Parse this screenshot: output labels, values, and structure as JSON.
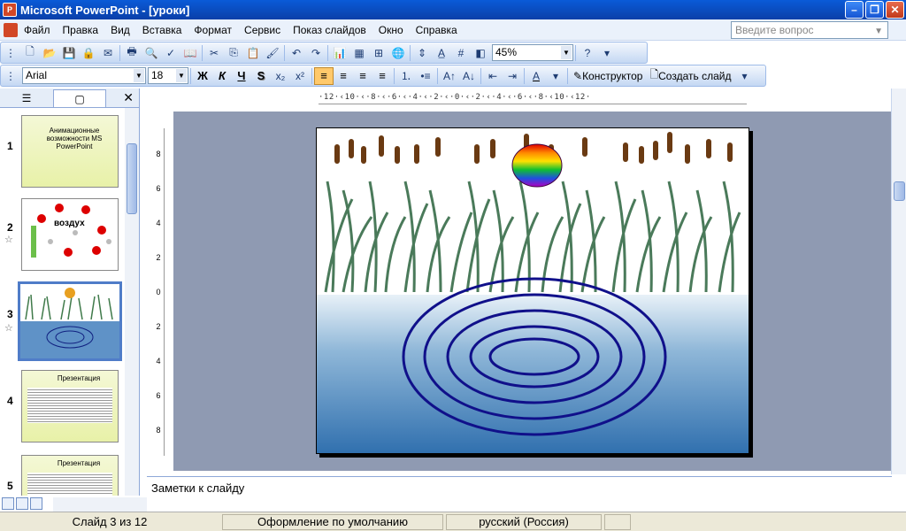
{
  "window": {
    "title": "Microsoft PowerPoint - [уроки]",
    "app_icon": "P"
  },
  "menu": {
    "items": [
      "Файл",
      "Правка",
      "Вид",
      "Вставка",
      "Формат",
      "Сервис",
      "Показ слайдов",
      "Окно",
      "Справка"
    ],
    "help_placeholder": "Введите вопрос"
  },
  "toolbar": {
    "zoom": "45%"
  },
  "format": {
    "font": "Arial",
    "size": "18",
    "bold": "Ж",
    "italic": "К",
    "underline": "Ч",
    "shadow": "S",
    "designer": "Конструктор",
    "new_slide": "Создать слайд"
  },
  "ruler": {
    "h_ticks": "·12·‹10·‹·8·‹·6·‹·4·‹·2·‹·0·‹·2·‹·4·‹·6·‹·8·‹10·‹12·",
    "v_ticks": [
      "8",
      "6",
      "4",
      "2",
      "0",
      "2",
      "4",
      "6",
      "8"
    ]
  },
  "thumbnails": [
    {
      "num": "1",
      "title": "Анимационные возможности MS PowerPoint",
      "star": false
    },
    {
      "num": "2",
      "title": "воздух",
      "star": true
    },
    {
      "num": "3",
      "title": "",
      "star": true,
      "selected": true
    },
    {
      "num": "4",
      "title": "Презентация",
      "star": false
    },
    {
      "num": "5",
      "title": "Презентация",
      "star": false
    }
  ],
  "notes": {
    "text": "Заметки к слайду"
  },
  "status": {
    "slide": "Слайд 3 из 12",
    "design": "Оформление по умолчанию",
    "language": "русский (Россия)"
  }
}
